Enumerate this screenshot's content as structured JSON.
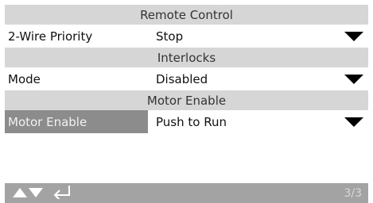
{
  "sections": [
    {
      "header": "Remote Control"
    },
    {
      "header": "Interlocks"
    },
    {
      "header": "Motor Enable"
    }
  ],
  "rows": [
    {
      "label": "2-Wire Priority",
      "value": "Stop"
    },
    {
      "label": "Mode",
      "value": "Disabled"
    },
    {
      "label": "Motor Enable",
      "value": "Push to Run"
    }
  ],
  "footer": {
    "page": "3/3",
    "icons": [
      "up-arrow-icon",
      "down-arrow-icon",
      "enter-icon"
    ]
  },
  "colors": {
    "header_bg": "#d6d6d6",
    "selected_bg": "#8c8c8c",
    "footer_bg": "#a3a3a3"
  }
}
